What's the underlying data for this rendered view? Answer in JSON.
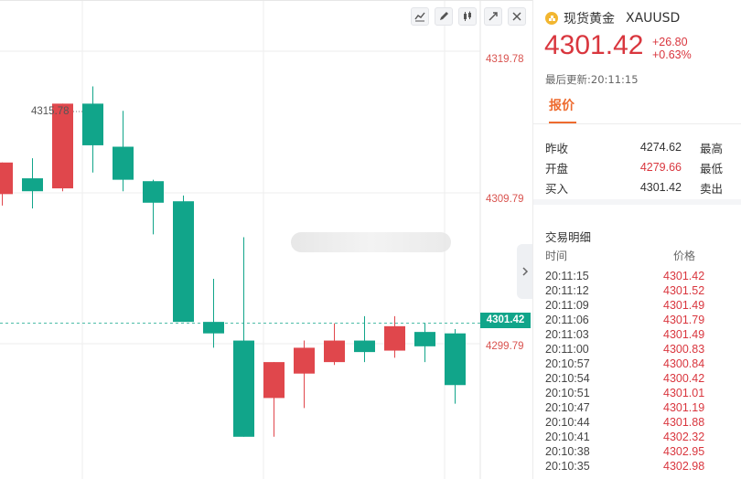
{
  "chart": {
    "toolbar_icons": [
      "line-chart-icon",
      "draw-pen-icon",
      "candle-icon",
      "expand-icon",
      "close-icon"
    ],
    "price_axis_labels": [
      "4319.78",
      "4309.79",
      "4299.79"
    ],
    "current_price_tag": "4301.42",
    "peak_label": "4315.78",
    "colors": {
      "up": "#e0474c",
      "down": "#11a58a",
      "grid": "#eeeeee",
      "current_line": "#11a58a"
    }
  },
  "chart_data": {
    "type": "candlestick",
    "y_axis_ticks": [
      4319.78,
      4309.79,
      4299.79
    ],
    "current_price": 4301.42,
    "annotated_high": 4315.78,
    "candles": [
      {
        "open": 4310.4,
        "close": 4312.6,
        "high": 4312.6,
        "low": 4309.6
      },
      {
        "open": 4311.5,
        "close": 4310.6,
        "high": 4312.9,
        "low": 4309.4
      },
      {
        "open": 4310.8,
        "close": 4316.7,
        "high": 4316.7,
        "low": 4310.6
      },
      {
        "open": 4316.7,
        "close": 4313.8,
        "high": 4317.9,
        "low": 4311.9
      },
      {
        "open": 4313.7,
        "close": 4311.4,
        "high": 4316.2,
        "low": 4310.6
      },
      {
        "open": 4311.3,
        "close": 4309.8,
        "high": 4311.4,
        "low": 4307.6
      },
      {
        "open": 4309.9,
        "close": 4301.5,
        "high": 4310.3,
        "low": 4301.5
      },
      {
        "open": 4301.5,
        "close": 4300.7,
        "high": 4304.5,
        "low": 4299.7
      },
      {
        "open": 4300.2,
        "close": 4293.5,
        "high": 4307.4,
        "low": 4293.5
      },
      {
        "open": 4296.2,
        "close": 4298.7,
        "high": 4298.7,
        "low": 4293.5
      },
      {
        "open": 4297.9,
        "close": 4299.7,
        "high": 4300.2,
        "low": 4295.5
      },
      {
        "open": 4298.7,
        "close": 4300.2,
        "high": 4301.4,
        "low": 4298.5
      },
      {
        "open": 4300.2,
        "close": 4299.4,
        "high": 4301.9,
        "low": 4298.7
      },
      {
        "open": 4299.5,
        "close": 4301.2,
        "high": 4301.9,
        "low": 4299.0
      },
      {
        "open": 4300.8,
        "close": 4299.8,
        "high": 4301.4,
        "low": 4298.7
      },
      {
        "open": 4300.7,
        "close": 4297.1,
        "high": 4301.0,
        "low": 4295.8
      }
    ]
  },
  "panel": {
    "symbol_name": "现货黄金",
    "symbol_code": "XAUUSD",
    "price": "4301.42",
    "change_abs": "+26.80",
    "change_pct": "+0.63%",
    "last_update": "最后更新:20:11:15",
    "tab_label": "报价",
    "quote_rows": [
      {
        "label": "昨收",
        "value": "4274.62",
        "label2": "最高",
        "red": false
      },
      {
        "label": "开盘",
        "value": "4279.66",
        "label2": "最低",
        "red": true
      },
      {
        "label": "买入",
        "value": "4301.42",
        "label2": "卖出",
        "red": false
      }
    ],
    "trades_title": "交易明细",
    "col_time": "时间",
    "col_price": "价格",
    "trades": [
      {
        "time": "20:11:15",
        "price": "4301.42"
      },
      {
        "time": "20:11:12",
        "price": "4301.52"
      },
      {
        "time": "20:11:09",
        "price": "4301.49"
      },
      {
        "time": "20:11:06",
        "price": "4301.79"
      },
      {
        "time": "20:11:03",
        "price": "4301.49"
      },
      {
        "time": "20:11:00",
        "price": "4300.83"
      },
      {
        "time": "20:10:57",
        "price": "4300.84"
      },
      {
        "time": "20:10:54",
        "price": "4300.42"
      },
      {
        "time": "20:10:51",
        "price": "4301.01"
      },
      {
        "time": "20:10:47",
        "price": "4301.19"
      },
      {
        "time": "20:10:44",
        "price": "4301.88"
      },
      {
        "time": "20:10:41",
        "price": "4302.32"
      },
      {
        "time": "20:10:38",
        "price": "4302.95"
      },
      {
        "time": "20:10:35",
        "price": "4302.98"
      }
    ]
  }
}
